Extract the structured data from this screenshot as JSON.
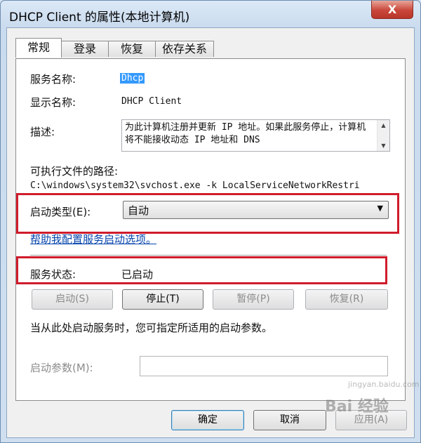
{
  "window": {
    "title": "DHCP Client 的属性(本地计算机)",
    "close_glyph": "X"
  },
  "tabs": [
    {
      "label": "常规"
    },
    {
      "label": "登录"
    },
    {
      "label": "恢复"
    },
    {
      "label": "依存关系"
    }
  ],
  "general": {
    "service_name_label": "服务名称:",
    "service_name": "Dhcp",
    "display_name_label": "显示名称:",
    "display_name": "DHCP Client",
    "description_label": "描述:",
    "description": "为此计算机注册并更新 IP 地址。如果此服务停止，计算机将不能接收动态 IP 地址和 DNS",
    "path_label": "可执行文件的路径:",
    "path": "C:\\windows\\system32\\svchost.exe -k LocalServiceNetworkRestri",
    "startup_type_label": "启动类型(E):",
    "startup_type": "自动",
    "help_link": "帮助我配置服务启动选项。",
    "status_label": "服务状态:",
    "status_value": "已启动",
    "start_button": "启动(S)",
    "stop_button": "停止(T)",
    "pause_button": "暂停(P)",
    "resume_button": "恢复(R)",
    "hint": "当从此处启动服务时，您可指定所适用的启动参数。",
    "params_label": "启动参数(M):",
    "params_value": ""
  },
  "footer": {
    "ok_button": "确定",
    "cancel_button": "取消",
    "apply_button": "应用(A)"
  },
  "watermark": {
    "text": "Bai 经验",
    "url": "jingyan.baidu.com"
  },
  "colors": {
    "highlight_box": "#d01c2c",
    "selection": "#3399ff",
    "link": "#0645ad"
  }
}
